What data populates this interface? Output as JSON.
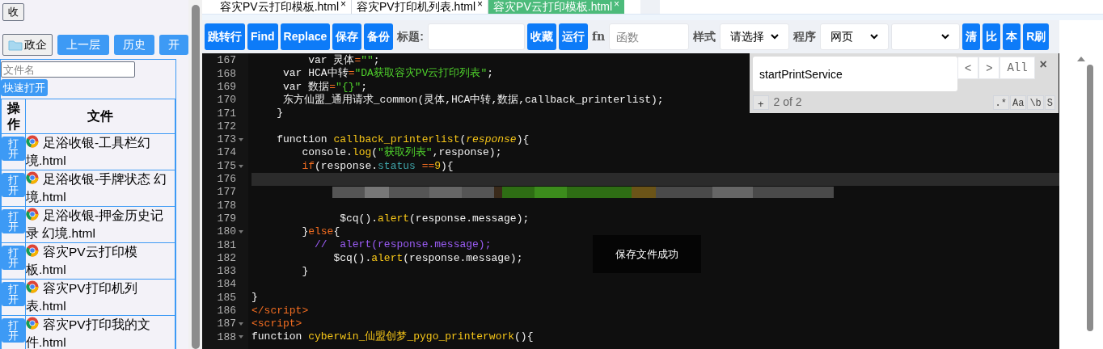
{
  "sidebar": {
    "collapse_button": "收",
    "folder_button": "政企",
    "nav_buttons": [
      "上一层",
      "历史",
      "开"
    ],
    "search": {
      "placeholder": "文件名"
    },
    "quick_open": "快速打开",
    "columns": [
      "操作",
      "文件"
    ],
    "files": [
      {
        "action": "打开",
        "name": "足浴收银-工具栏幻境.html"
      },
      {
        "action": "打开",
        "name": "足浴收银-手牌状态 幻境.html"
      },
      {
        "action": "打开",
        "name": "足浴收银-押金历史记录 幻境.html"
      },
      {
        "action": "打开",
        "name": "容灾PV云打印模板.html"
      },
      {
        "action": "打开",
        "name": "容灾PV打印机列表.html"
      },
      {
        "action": "打开",
        "name": "容灾PV打印我的文件.html"
      }
    ]
  },
  "tabs": [
    {
      "label": "容灾PV云打印模板.html",
      "close": "×",
      "selected": false
    },
    {
      "label": "容灾PV打印机列表.html",
      "close": "×",
      "selected": false
    },
    {
      "label": "容灾PV云打印模板.html",
      "close": "×",
      "selected": true
    }
  ],
  "toolbar": {
    "buttons_left": [
      "跳转行",
      "Find",
      "Replace",
      "保存",
      "备份"
    ],
    "title_label": "标题:",
    "buttons_mid": [
      "收藏",
      "运行"
    ],
    "fn_label": "fn",
    "fn_field": {
      "placeholder": "函数"
    },
    "style_label": "样式",
    "style_select": "请选择",
    "program_label": "程序",
    "program_select": "网页",
    "buttons_right": [
      "清",
      "比",
      "本",
      "R刷"
    ]
  },
  "editor": {
    "lines": [
      {
        "number": "167",
        "fold": false,
        "active": false,
        "kind": "code",
        "tokens": [
          {
            "kind": "plain",
            "t": "         var 灵体"
          },
          {
            "kind": "op",
            "t": "="
          },
          {
            "kind": "string",
            "t": "\"\""
          },
          {
            "kind": "plain",
            "t": ";"
          }
        ]
      },
      {
        "number": "168",
        "fold": false,
        "active": false,
        "kind": "code",
        "tokens": [
          {
            "kind": "plain",
            "t": "     var HCA中转"
          },
          {
            "kind": "op",
            "t": "="
          },
          {
            "kind": "string",
            "t": "\"DA获取容灾PV云打印列表\""
          },
          {
            "kind": "plain",
            "t": ";"
          }
        ]
      },
      {
        "number": "169",
        "fold": false,
        "active": false,
        "kind": "code",
        "tokens": [
          {
            "kind": "plain",
            "t": "     var 数据"
          },
          {
            "kind": "op",
            "t": "="
          },
          {
            "kind": "string",
            "t": "\"{}\""
          },
          {
            "kind": "plain",
            "t": ";"
          }
        ]
      },
      {
        "number": "170",
        "fold": false,
        "active": false,
        "kind": "code",
        "tokens": [
          {
            "kind": "plain",
            "t": "     东方仙盟_通用请求_common(灵体,HCA中转,数据,callback_printerlist);"
          }
        ]
      },
      {
        "number": "171",
        "fold": false,
        "active": false,
        "kind": "code",
        "tokens": [
          {
            "kind": "plain",
            "t": "    }"
          }
        ]
      },
      {
        "number": "172",
        "fold": false,
        "active": false,
        "kind": "code"
      },
      {
        "number": "173",
        "fold": true,
        "active": false,
        "kind": "code",
        "tokens": [
          {
            "kind": "plain",
            "t": "    function "
          },
          {
            "kind": "func",
            "t": "callback_printerlist"
          },
          {
            "kind": "plain",
            "t": "("
          },
          {
            "kind": "param",
            "t": "response"
          },
          {
            "kind": "plain",
            "t": "){"
          }
        ]
      },
      {
        "number": "174",
        "fold": false,
        "active": false,
        "kind": "code",
        "tokens": [
          {
            "kind": "plain",
            "t": "        console."
          },
          {
            "kind": "func",
            "t": "log"
          },
          {
            "kind": "plain",
            "t": "("
          },
          {
            "kind": "string",
            "t": "\"获取列表\""
          },
          {
            "kind": "plain",
            "t": ",response);"
          }
        ]
      },
      {
        "number": "175",
        "fold": true,
        "active": false,
        "kind": "code",
        "tokens": [
          {
            "kind": "keyword",
            "t": "        if"
          },
          {
            "kind": "plain",
            "t": "(response."
          },
          {
            "kind": "member",
            "t": "status"
          },
          {
            "kind": "op",
            "t": " =="
          },
          {
            "kind": "func",
            "t": "9"
          },
          {
            "kind": "plain",
            "t": "){"
          }
        ]
      },
      {
        "number": "176",
        "fold": false,
        "active": true,
        "kind": "code"
      },
      {
        "number": "177",
        "fold": false,
        "active": false,
        "kind": "redacted"
      },
      {
        "number": "178",
        "fold": false,
        "active": false,
        "kind": "code"
      },
      {
        "number": "179",
        "fold": false,
        "active": false,
        "kind": "code",
        "tokens": [
          {
            "kind": "plain",
            "t": "              $cq()."
          },
          {
            "kind": "func",
            "t": "alert"
          },
          {
            "kind": "plain",
            "t": "(response.message);"
          }
        ]
      },
      {
        "number": "180",
        "fold": true,
        "active": false,
        "kind": "code",
        "tokens": [
          {
            "kind": "plain",
            "t": "        }"
          },
          {
            "kind": "keyword",
            "t": "else"
          },
          {
            "kind": "plain",
            "t": "{"
          }
        ]
      },
      {
        "number": "181",
        "fold": false,
        "active": false,
        "kind": "code",
        "tokens": [
          {
            "kind": "comment",
            "t": "          //  alert(response.message);"
          }
        ]
      },
      {
        "number": "182",
        "fold": false,
        "active": false,
        "kind": "code",
        "tokens": [
          {
            "kind": "plain",
            "t": "             $cq()."
          },
          {
            "kind": "func",
            "t": "alert"
          },
          {
            "kind": "plain",
            "t": "(response.message);"
          }
        ]
      },
      {
        "number": "183",
        "fold": false,
        "active": false,
        "kind": "code",
        "tokens": [
          {
            "kind": "plain",
            "t": "        }"
          }
        ]
      },
      {
        "number": "184",
        "fold": false,
        "active": false,
        "kind": "code"
      },
      {
        "number": "185",
        "fold": false,
        "active": false,
        "kind": "code",
        "tokens": [
          {
            "kind": "plain",
            "t": "}"
          }
        ]
      },
      {
        "number": "186",
        "fold": false,
        "active": false,
        "kind": "code",
        "tokens": [
          {
            "kind": "keyword",
            "t": "</script>"
          }
        ]
      },
      {
        "number": "187",
        "fold": true,
        "active": false,
        "kind": "code",
        "tokens": [
          {
            "kind": "keyword",
            "t": "<script>"
          }
        ]
      },
      {
        "number": "188",
        "fold": true,
        "active": false,
        "kind": "code",
        "tokens": [
          {
            "kind": "plain",
            "t": "function "
          },
          {
            "kind": "func",
            "t": "cyberwin_仙盟创梦_pygo_printerwork"
          },
          {
            "kind": "plain",
            "t": "(){"
          }
        ]
      }
    ]
  },
  "find_panel": {
    "query": "startPrintService",
    "prev": "<",
    "next": ">",
    "all": "All",
    "close": "×",
    "add": "+",
    "count": "2 of 2",
    "options": [
      ".*",
      "Aa",
      "\\b",
      "S"
    ]
  },
  "toast": "保存文件成功"
}
